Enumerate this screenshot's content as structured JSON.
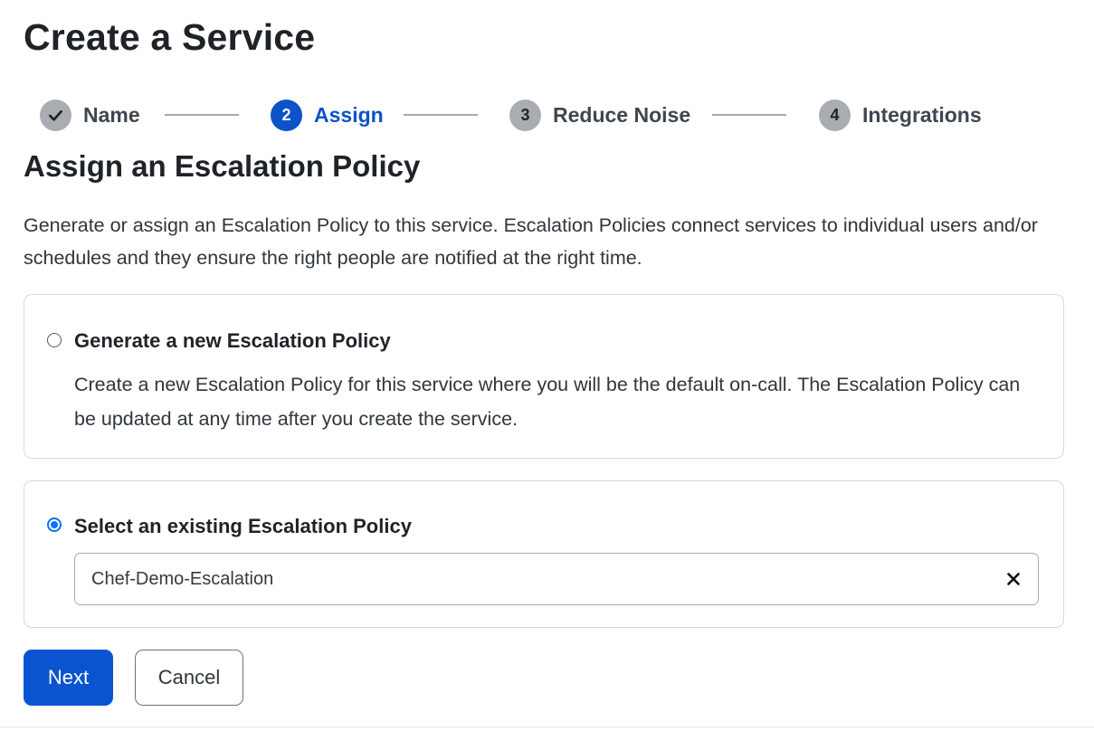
{
  "page": {
    "title": "Create a Service"
  },
  "stepper": {
    "steps": [
      {
        "number": "",
        "label": "Name",
        "state": "completed",
        "icon": "check-icon"
      },
      {
        "number": "2",
        "label": "Assign",
        "state": "active"
      },
      {
        "number": "3",
        "label": "Reduce Noise",
        "state": "upcoming"
      },
      {
        "number": "4",
        "label": "Integrations",
        "state": "upcoming"
      }
    ]
  },
  "section": {
    "title": "Assign an Escalation Policy",
    "description": "Generate or assign an Escalation Policy to this service. Escalation Policies connect services to individual users and/or schedules and they ensure the right people are notified at the right time."
  },
  "options": {
    "generate": {
      "title": "Generate a new Escalation Policy",
      "description": "Create a new Escalation Policy for this service where you will be the default on-call. The Escalation Policy can be updated at any time after you create the service.",
      "selected": false
    },
    "existing": {
      "title": "Select an existing Escalation Policy",
      "selected": true,
      "selected_value": "Chef-Demo-Escalation",
      "clear_icon": "close-icon"
    }
  },
  "buttons": {
    "next_label": "Next",
    "cancel_label": "Cancel"
  },
  "colors": {
    "accent": "#0d53c8",
    "inactive_step": "#a9adb2",
    "radio_checked": "#0d6efd"
  }
}
